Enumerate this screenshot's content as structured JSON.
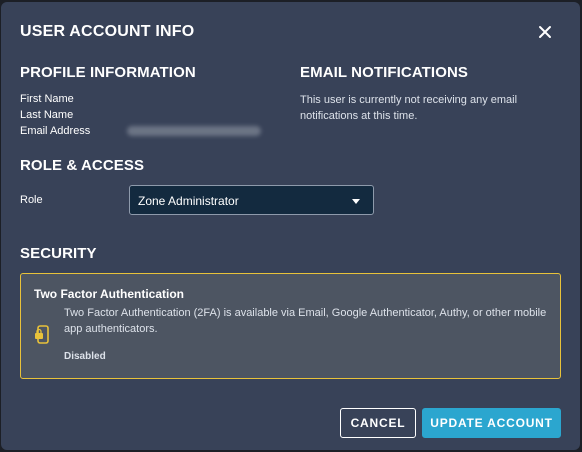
{
  "modal": {
    "title": "USER ACCOUNT INFO",
    "close_icon": "close-icon"
  },
  "profile": {
    "heading": "PROFILE INFORMATION",
    "first_name_label": "First Name",
    "last_name_label": "Last Name",
    "email_label": "Email Address"
  },
  "notifications": {
    "heading": "EMAIL NOTIFICATIONS",
    "text": "This user is currently not receiving any email notifications at this time."
  },
  "role_access": {
    "heading": "ROLE & ACCESS",
    "role_label": "Role",
    "role_value": "Zone Administrator"
  },
  "security": {
    "heading": "SECURITY",
    "tfa_title": "Two Factor Authentication",
    "tfa_description": "Two Factor Authentication (2FA) is available via Email, Google Authenticator, Authy, or other mobile app authenticators.",
    "tfa_status": "Disabled",
    "icon": "phone-lock-icon",
    "border_color": "#e8c23a"
  },
  "actions": {
    "cancel_label": "CANCEL",
    "update_label": "UPDATE ACCOUNT"
  },
  "colors": {
    "background": "#384258",
    "accent": "#2ba6cf",
    "select_bg": "#132a3f"
  }
}
